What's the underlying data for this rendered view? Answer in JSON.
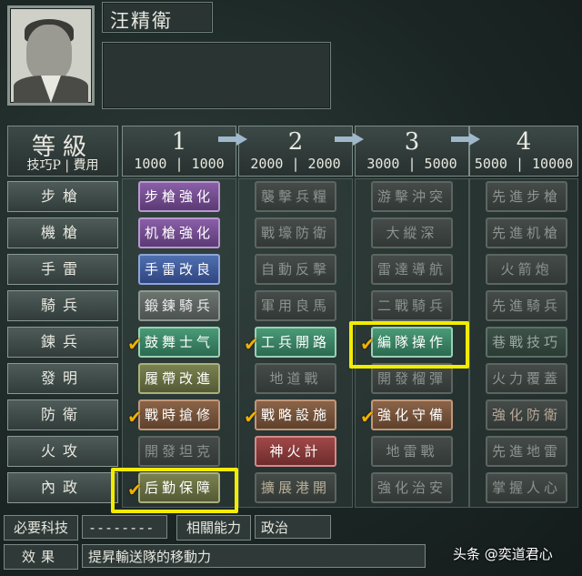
{
  "character": {
    "name": "汪精衛"
  },
  "header": {
    "grade_label": "等級",
    "skill_label": "技巧P",
    "cost_label": "費用"
  },
  "levels": [
    {
      "num": "1",
      "skill": "1000",
      "cost": "1000"
    },
    {
      "num": "2",
      "skill": "2000",
      "cost": "2000"
    },
    {
      "num": "3",
      "skill": "3000",
      "cost": "5000"
    },
    {
      "num": "4",
      "skill": "5000",
      "cost": "10000"
    }
  ],
  "rows": [
    {
      "label": "步槍",
      "cells": [
        "步槍強化",
        "襲擊兵糧",
        "游擊沖突",
        "先進步槍"
      ]
    },
    {
      "label": "機槍",
      "cells": [
        "机槍強化",
        "戰壕防衛",
        "大縱深",
        "先進机槍"
      ]
    },
    {
      "label": "手雷",
      "cells": [
        "手雷改良",
        "自動反擊",
        "雷達導航",
        "火箭炮"
      ]
    },
    {
      "label": "騎兵",
      "cells": [
        "鍛鍊騎兵",
        "軍用良馬",
        "二戰騎兵",
        "先進騎兵"
      ]
    },
    {
      "label": "鍊兵",
      "cells": [
        "鼓舞士气",
        "工兵開路",
        "編隊操作",
        "巷戰技巧"
      ]
    },
    {
      "label": "發明",
      "cells": [
        "履帶改進",
        "地道戰",
        "開發榴彈",
        "火力覆蓋"
      ]
    },
    {
      "label": "防衛",
      "cells": [
        "戰時搶修",
        "戰略設施",
        "強化守備",
        "強化防衛"
      ]
    },
    {
      "label": "火攻",
      "cells": [
        "開發坦克",
        "神火計",
        "地雷戰",
        "先進地雷"
      ]
    },
    {
      "label": "內政",
      "cells": [
        "后勤保障",
        "擴展港開",
        "強化治安",
        "掌握人心"
      ]
    }
  ],
  "footer": {
    "required_label": "必要科技",
    "required_value": "--------",
    "related_label": "相關能力",
    "related_value": "政治",
    "effect_label": "效果",
    "effect_value": "提昇輸送隊的移動力"
  },
  "watermark": "头条 @奕道君心",
  "colors": {
    "highlight": "#f2ec00",
    "check": "#f0b000"
  }
}
